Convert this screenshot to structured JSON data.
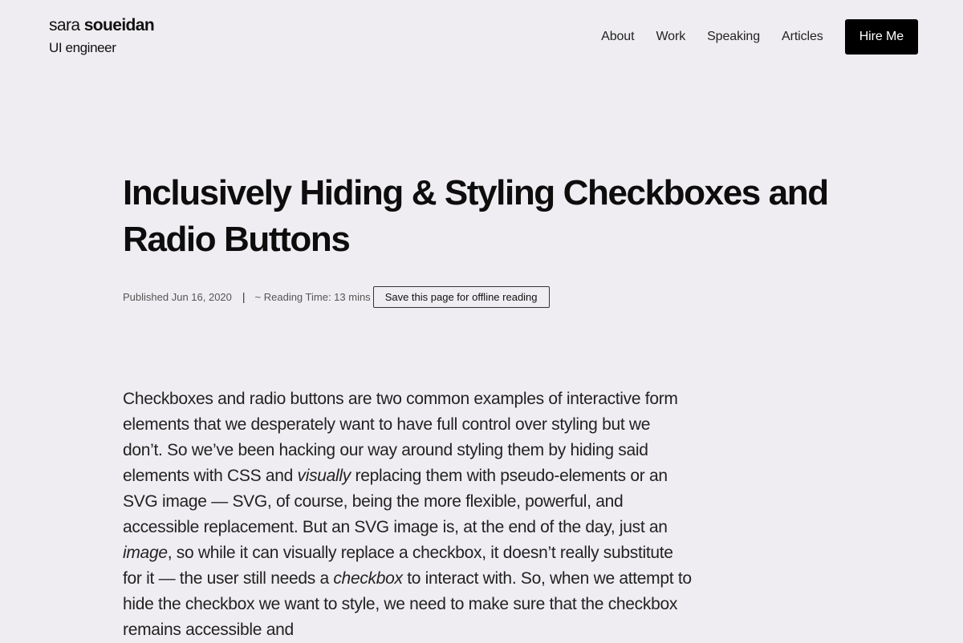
{
  "header": {
    "brand_first": "sara",
    "brand_last": "soueidan",
    "role": "UI engineer"
  },
  "nav": {
    "items": [
      {
        "label": "About"
      },
      {
        "label": "Work"
      },
      {
        "label": "Speaking"
      },
      {
        "label": "Articles"
      }
    ],
    "cta_label": "Hire Me"
  },
  "article": {
    "title": "Inclusively Hiding & Styling Checkboxes and Radio Buttons",
    "meta": {
      "published": "Published Jun 16, 2020",
      "separator": "|",
      "reading_time": "~ Reading Time: 13 mins",
      "save_label": "Save this page for offline reading"
    },
    "paragraph": {
      "s1": "Checkboxes and radio buttons are two common examples of interactive form elements that we desperately want to have full control over styling but we don’t. So we’ve been hacking our way around styling them by hiding said elements with CSS and ",
      "em1": "visually",
      "s2": " replacing them with pseudo-elements or an SVG image — SVG, of course, being the more flexible, powerful, and accessible replacement. But an SVG image is, at the end of the day, just an ",
      "em2": "image",
      "s3": ", so while it can visually replace a checkbox, it doesn’t really substitute for it — the user still needs a ",
      "em3": "checkbox",
      "s4": " to interact with. So, when we attempt to hide the checkbox we want to style, we need to make sure that the checkbox remains accessible and"
    }
  }
}
